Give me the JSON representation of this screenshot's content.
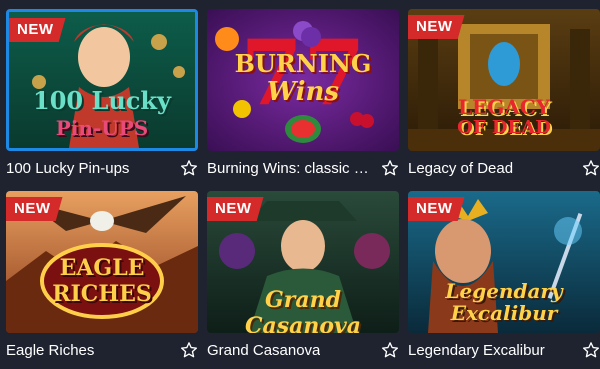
{
  "games": [
    {
      "title": "100 Lucky Pin-ups",
      "badge": "NEW",
      "art_text": [
        "100 Lucky",
        "Pin-UPS"
      ]
    },
    {
      "title": "Burning Wins: classic …",
      "badge": "",
      "art_text": [
        "BURNING",
        "Wins"
      ]
    },
    {
      "title": "Legacy of Dead",
      "badge": "NEW",
      "art_text": [
        "LEGACY",
        "OF DEAD"
      ]
    },
    {
      "title": "Eagle Riches",
      "badge": "NEW",
      "art_text": [
        "EAGLE",
        "RICHES"
      ]
    },
    {
      "title": "Grand Casanova",
      "badge": "NEW",
      "art_text": [
        "Grand Casanova"
      ]
    },
    {
      "title": "Legendary Excalibur",
      "badge": "NEW",
      "art_text": [
        "Legendary",
        "Excalibur"
      ]
    }
  ],
  "colors": {
    "background": "#1f2330",
    "badge": "#d42a2a",
    "selected_border": "#1e88e5"
  },
  "icons": {
    "favorite": "star-outline-icon"
  }
}
